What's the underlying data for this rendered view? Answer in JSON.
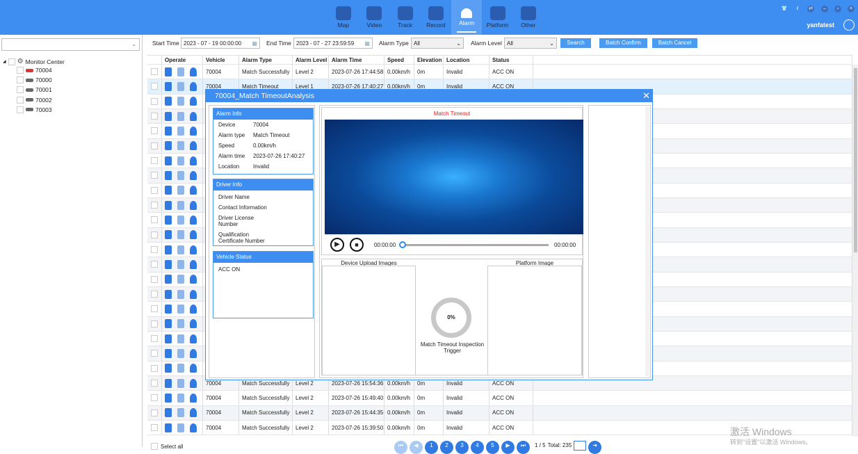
{
  "nav": [
    {
      "label": "Map",
      "icon": "monitor-eye-icon"
    },
    {
      "label": "Video",
      "icon": "webcam-icon"
    },
    {
      "label": "Track",
      "icon": "route-icon"
    },
    {
      "label": "Record",
      "icon": "film-icon"
    },
    {
      "label": "Alarm",
      "icon": "siren-icon",
      "active": true
    },
    {
      "label": "Platform",
      "icon": "gear-icon"
    },
    {
      "label": "Other",
      "icon": "cube-icon"
    }
  ],
  "user": "yanfatest",
  "tree": {
    "root": "Monitor Center",
    "vehicles": [
      "70004",
      "70000",
      "70001",
      "70002",
      "70003"
    ]
  },
  "filter": {
    "start_label": "Start Time",
    "start": "2023 - 07 - 19 00:00:00",
    "end_label": "End Time",
    "end": "2023 - 07 - 27 23:59:59",
    "type_label": "Alarm Type",
    "type": "All",
    "level_label": "Alarm Level",
    "level": "All",
    "search": "Search",
    "batch_confirm": "Batch Confirm",
    "batch_cancel": "Batch Cancel"
  },
  "columns": [
    "Operate",
    "Vehicle",
    "Alarm Type",
    "Alarm Level",
    "Alarm Time",
    "Speed",
    "Elevation",
    "Location",
    "Status"
  ],
  "rows": [
    [
      "70004",
      "Match Successfully",
      "Level 2",
      "2023-07-26 17:44:58",
      "0.00km/h",
      "0m",
      "Invalid",
      "ACC ON"
    ],
    [
      "70004",
      "Match Timeout",
      "Level 1",
      "2023-07-26 17:40:27",
      "0.00km/h",
      "0m",
      "Invalid",
      "ACC ON"
    ],
    [],
    [],
    [],
    [],
    [],
    [],
    [],
    [],
    [],
    [],
    [],
    [],
    [],
    [],
    [],
    [],
    [],
    [],
    [],
    [
      "70004",
      "Match Successfully",
      "Level 2",
      "2023-07-26 15:54:36",
      "0.00km/h",
      "0m",
      "Invalid",
      "ACC ON"
    ],
    [
      "70004",
      "Match Successfully",
      "Level 2",
      "2023-07-26 15:49:40",
      "0.00km/h",
      "0m",
      "Invalid",
      "ACC ON"
    ],
    [
      "70004",
      "Match Successfully",
      "Level 2",
      "2023-07-26 15:44:35",
      "0.00km/h",
      "0m",
      "Invalid",
      "ACC ON"
    ],
    [
      "70004",
      "Match Successfully",
      "Level 2",
      "2023-07-26 15:39:50",
      "0.00km/h",
      "0m",
      "Invalid",
      "ACC ON"
    ]
  ],
  "footer": {
    "select_all": "Select all",
    "pages": [
      "1",
      "2",
      "3",
      "4",
      "5"
    ],
    "page_info": "1 / 5",
    "total": "Total: 235"
  },
  "modal": {
    "title": "70004_Match TimeoutAnalysis",
    "alarm_info": {
      "title": "Alarm Info",
      "items": [
        [
          "Device",
          "70004"
        ],
        [
          "Alarm type",
          "Match Timeout"
        ],
        [
          "Speed",
          "0.00km/h"
        ],
        [
          "Alarm time",
          "2023-07-26 17:40:27"
        ],
        [
          "Location",
          "Invalid"
        ]
      ]
    },
    "driver_info": {
      "title": "Driver Info",
      "items": [
        "Driver Name",
        "Contact Information",
        "Driver License Number",
        "Qualification Certificate Number"
      ]
    },
    "vehicle_status": {
      "title": "Vehicle Status",
      "value": "ACC ON"
    },
    "video_title": "Match Timeout",
    "time_start": "00:00:00",
    "time_end": "00:00:00",
    "progress": 0,
    "device_images": "Device Upload Images",
    "platform_image": "Platform Image",
    "percent": "0%",
    "trigger": "Match Timeout Inspection Trigger"
  },
  "watermark": {
    "line1": "激活 Windows",
    "line2": "转到\"设置\"以激活 Windows。"
  },
  "colors": {
    "primary": "#3d8ef0",
    "alarm_red": "#e02020"
  }
}
